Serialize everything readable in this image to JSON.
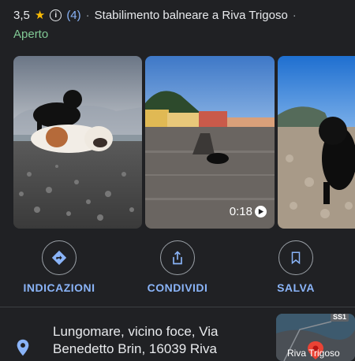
{
  "header": {
    "rating": "3,5",
    "reviews": "(4)",
    "category": "Stabilimento balneare a Riva Trigoso",
    "trailing_dot": "·",
    "status": "Aperto"
  },
  "photos": [
    {
      "label": "photo-dogs-on-pebble-beach"
    },
    {
      "label": "video-beach-with-dog",
      "duration": "0:18"
    },
    {
      "label": "photo-black-labrador-on-sand"
    }
  ],
  "actions": [
    {
      "label": "INDICAZIONI",
      "icon": "directions-icon"
    },
    {
      "label": "CONDIVIDI",
      "icon": "share-icon"
    },
    {
      "label": "SALVA",
      "icon": "bookmark-icon"
    }
  ],
  "address": {
    "line1": "Lungomare, vicino foce, Via",
    "line2": "Benedetto Brin, 16039 Riva"
  },
  "map": {
    "label": "Riva Trigoso",
    "road_badge": "SS1"
  },
  "colors": {
    "background": "#202124",
    "accent": "#8ab4f8",
    "open": "#81c995",
    "star": "#fbbc04"
  }
}
